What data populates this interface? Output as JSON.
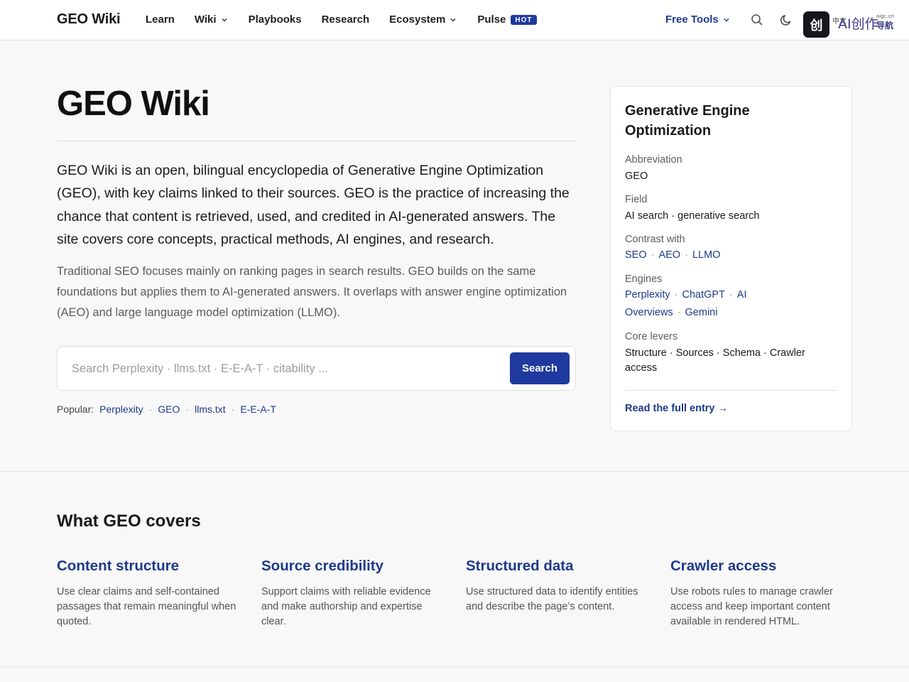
{
  "header": {
    "brand": "GEO Wiki",
    "nav": [
      {
        "label": "Learn"
      },
      {
        "label": "Wiki"
      },
      {
        "label": "Playbooks"
      },
      {
        "label": "Research"
      },
      {
        "label": "Ecosystem"
      },
      {
        "label": "Pulse",
        "badge": "HOT"
      }
    ],
    "free_tools": "Free Tools",
    "logo": {
      "glyph": "创",
      "small": "中文",
      "text": "AI创作",
      "nav": "导航",
      "url": "aigc.cn"
    }
  },
  "hero": {
    "title": "GEO Wiki",
    "lead": "GEO Wiki is an open, bilingual encyclopedia of Generative Engine Optimization (GEO), with key claims linked to their sources. GEO is the practice of increasing the chance that content is retrieved, used, and credited in AI-generated answers. The site covers core concepts, practical methods, AI engines, and research.",
    "sub": "Traditional SEO focuses mainly on ranking pages in search results. GEO builds on the same foundations but applies them to AI-generated answers. It overlaps with answer engine optimization (AEO) and large language model optimization (LLMO).",
    "search": {
      "placeholder": "Search Perplexity · llms.txt · E-E-A-T · citability ...",
      "value": "",
      "button": "Search"
    },
    "popular": {
      "label": "Popular:",
      "links": [
        "Perplexity",
        "GEO",
        "llms.txt",
        "E-E-A-T"
      ],
      "separator": "·"
    }
  },
  "card": {
    "title": "Generative Engine Optimization",
    "abbreviation": {
      "label": "Abbreviation",
      "value": "GEO"
    },
    "field": {
      "label": "Field",
      "value": "AI search · generative search"
    },
    "contrast": {
      "label": "Contrast with",
      "links": [
        "SEO",
        "AEO",
        "LLMO"
      ]
    },
    "engines": {
      "label": "Engines",
      "links": [
        "Perplexity",
        "ChatGPT",
        "AI Overviews",
        "Gemini"
      ]
    },
    "levers": {
      "label": "Core levers",
      "value": "Structure · Sources · Schema · Crawler access"
    },
    "read_more": "Read the full entry →"
  },
  "covers": {
    "title": "What GEO covers",
    "items": [
      {
        "title": "Content structure",
        "desc": "Use clear claims and self-contained passages that remain meaningful when quoted."
      },
      {
        "title": "Source credibility",
        "desc": "Support claims with reliable evidence and make authorship and expertise clear."
      },
      {
        "title": "Structured data",
        "desc": "Use structured data to identify entities and describe the page’s content."
      },
      {
        "title": "Crawler access",
        "desc": "Use robots rules to manage crawler access and keep important content available in rendered HTML."
      }
    ]
  },
  "colors": {
    "accent": "#1e3a9e",
    "link": "#1e3a8a",
    "background": "#f8f8f8"
  },
  "icons": {
    "search": "search-icon",
    "theme": "moon-icon",
    "dropdown": "chevron-down-icon"
  }
}
